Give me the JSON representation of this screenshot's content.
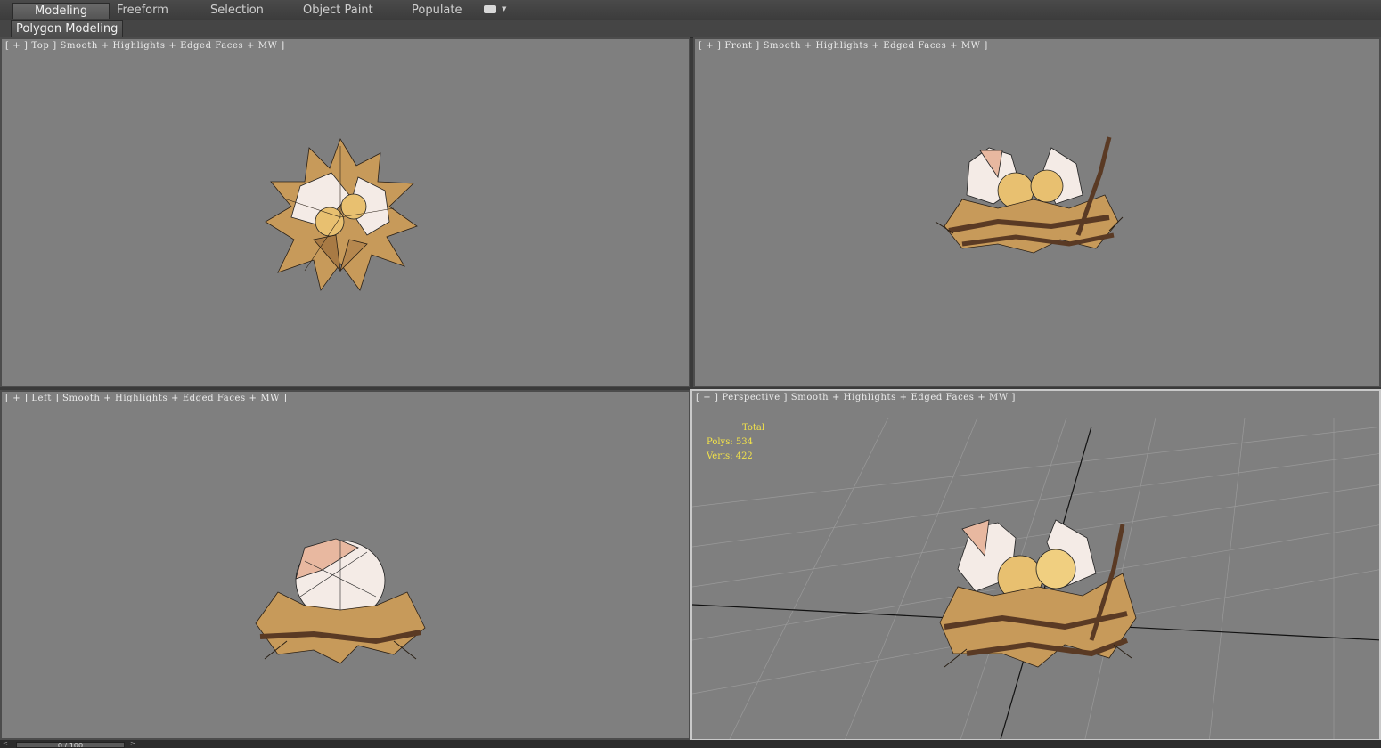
{
  "ribbon": {
    "tabs": [
      {
        "label": "Modeling",
        "active": true
      },
      {
        "label": "Freeform"
      },
      {
        "label": "Selection"
      },
      {
        "label": "Object Paint"
      },
      {
        "label": "Populate"
      }
    ],
    "panel_label": "Polygon Modeling"
  },
  "viewports": {
    "top": {
      "label": "[ + ] Top ] Smooth + Highlights + Edged Faces + MW ]"
    },
    "front": {
      "label": "[ + ] Front ] Smooth + Highlights + Edged Faces + MW ]"
    },
    "left": {
      "label": "[ + ] Left ] Smooth + Highlights + Edged Faces + MW ]"
    },
    "perspective": {
      "label": "[ + ] Perspective ] Smooth + Highlights + Edged Faces + MW ]",
      "active": true,
      "stats": {
        "title": "Total",
        "polys": "Polys: 534",
        "verts": "Verts: 422"
      }
    }
  },
  "timeline": {
    "frame": "0 / 100"
  },
  "colors": {
    "viewport_bg": "#7f7f7f",
    "stats_text": "#f2e24a",
    "straw": "#c79a5a",
    "twig": "#5a3a24",
    "egg": "#f4ebe6",
    "chick": "#e8c070"
  }
}
